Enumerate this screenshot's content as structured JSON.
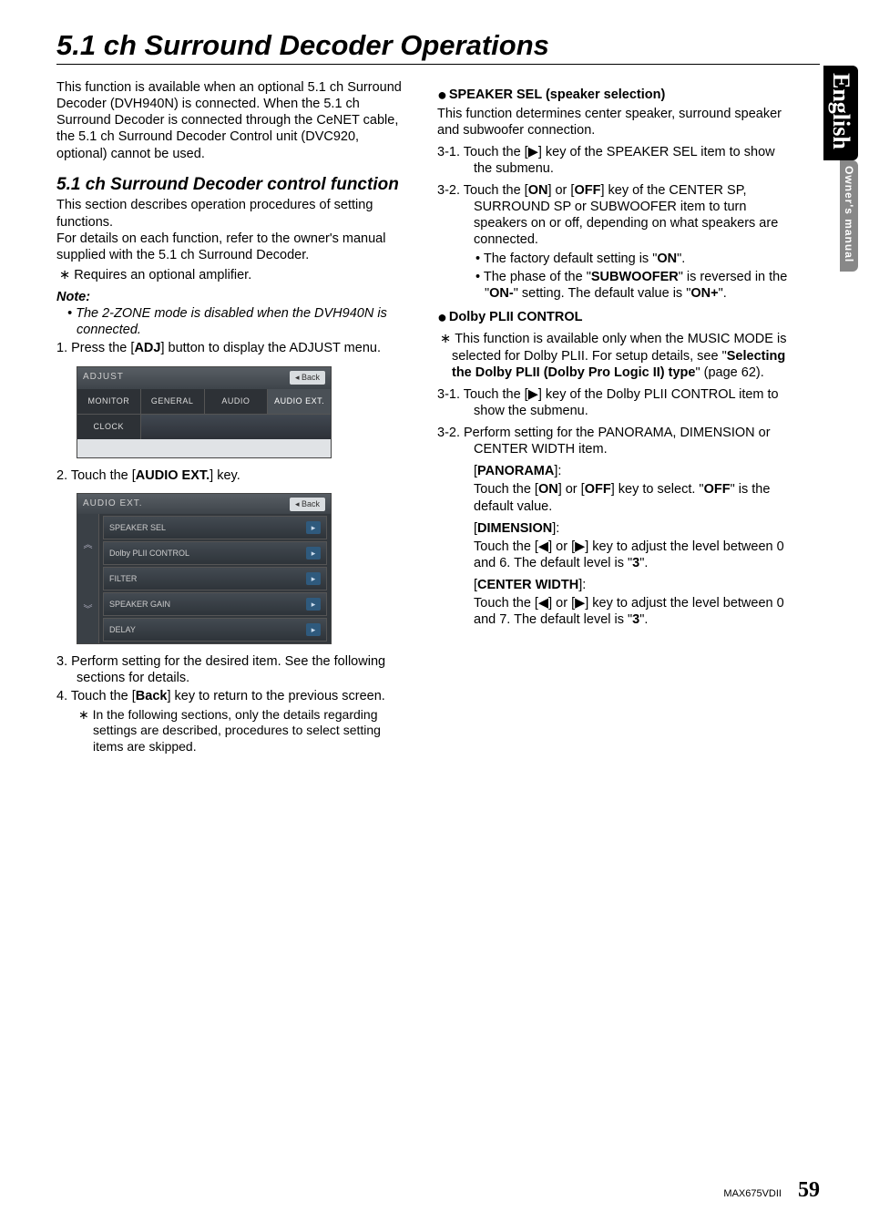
{
  "sideTabs": {
    "english": "English",
    "owners": "Owner's manual"
  },
  "title": "5.1 ch Surround Decoder Operations",
  "left": {
    "intro": "This function is available when an optional 5.1 ch Surround Decoder (DVH940N) is connected. When the 5.1 ch Surround Decoder is connected through the CeNET cable, the 5.1 ch Surround Decoder Control unit (DVC920, optional) cannot be used.",
    "subheading": "5.1 ch Surround Decoder control function",
    "sec1": "This section describes operation procedures of setting functions.",
    "sec2": "For details on each function, refer to the owner's manual supplied with the 5.1 ch Surround Decoder.",
    "ast1pre": "∗",
    "ast1": "Requires an optional amplifier.",
    "noteLabel": "Note:",
    "noteBullet": "• The 2-ZONE mode is disabled when the DVH940N is connected.",
    "step1a": "1.  Press the [",
    "step1b": "ADJ",
    "step1c": "] button to display the ADJUST menu.",
    "ss1": {
      "title": "ADJUST",
      "back": "◂ Back",
      "tabs": [
        "MONITOR",
        "GENERAL",
        "AUDIO",
        "AUDIO EXT."
      ],
      "tabs2": [
        "CLOCK"
      ]
    },
    "step2a": "2.  Touch the [",
    "step2b": "AUDIO EXT.",
    "step2c": "] key.",
    "ss2": {
      "title": "AUDIO EXT.",
      "back": "◂ Back",
      "rows": [
        "SPEAKER SEL",
        "Dolby PLII CONTROL",
        "FILTER",
        "SPEAKER GAIN",
        "DELAY"
      ],
      "up": "︽",
      "down": "︾"
    },
    "step3": "3.  Perform setting for the desired item. See the following sections for details.",
    "step4a": "4.  Touch the [",
    "step4b": "Back",
    "step4c": "] key to return to the previous screen.",
    "step4sub": "∗  In the following sections, only the details regarding settings are described, procedures to select setting items are skipped."
  },
  "right": {
    "h1": "SPEAKER SEL (speaker selection)",
    "h1txt": "This function determines center speaker, surround speaker and subwoofer connection.",
    "r31": "3-1.  Touch the [▶] key of the SPEAKER SEL item to show the submenu.",
    "r32a": "3-2.  Touch the [",
    "r32on": "ON",
    "r32b": "] or [",
    "r32off": "OFF",
    "r32c": "] key of the CENTER SP, SURROUND SP or SUBWOOFER item to turn speakers on or off, depending on what speakers are connected.",
    "r32s1a": "• The factory default setting is \"",
    "r32s1b": "ON",
    "r32s1c": "\".",
    "r32s2a": "• The phase of the \"",
    "r32s2b": "SUBWOOFER",
    "r32s2c": "\" is reversed in the \"",
    "r32s2d": "ON-",
    "r32s2e": "\" setting. The default value is \"",
    "r32s2f": "ON+",
    "r32s2g": "\".",
    "h2": "Dolby PLII CONTROL",
    "h2ast": "∗",
    "h2txt1": "This function is available only when the MUSIC MODE is selected for Dolby PLII. For setup details, see \"",
    "h2txt2": "Selecting the Dolby PLII (Dolby Pro Logic II) type",
    "h2txt3": "\" (page 62).",
    "r231": "3-1.  Touch the [▶] key of the Dolby PLII CONTROL item to show the submenu.",
    "r232": "3-2.  Perform setting for the PANORAMA, DIMENSION or CENTER WIDTH item.",
    "pan_h": "PANORAMA",
    "pan_a": "Touch the [",
    "pan_on": "ON",
    "pan_b": "] or [",
    "pan_off": "OFF",
    "pan_c": "] key to select. \"",
    "pan_off2": "OFF",
    "pan_d": "\" is the default value.",
    "dim_h": "DIMENSION",
    "dim_t1": "Touch the [◀] or [▶] key to adjust the level between 0 and 6. The default level is \"",
    "dim_t2": "3",
    "dim_t3": "\".",
    "cw_h": "CENTER WIDTH",
    "cw_t1": "Touch the [◀] or [▶] key to adjust the level between 0 and 7. The default level is \"",
    "cw_t2": "3",
    "cw_t3": "\"."
  },
  "footer": {
    "model": "MAX675VDII",
    "page": "59"
  }
}
